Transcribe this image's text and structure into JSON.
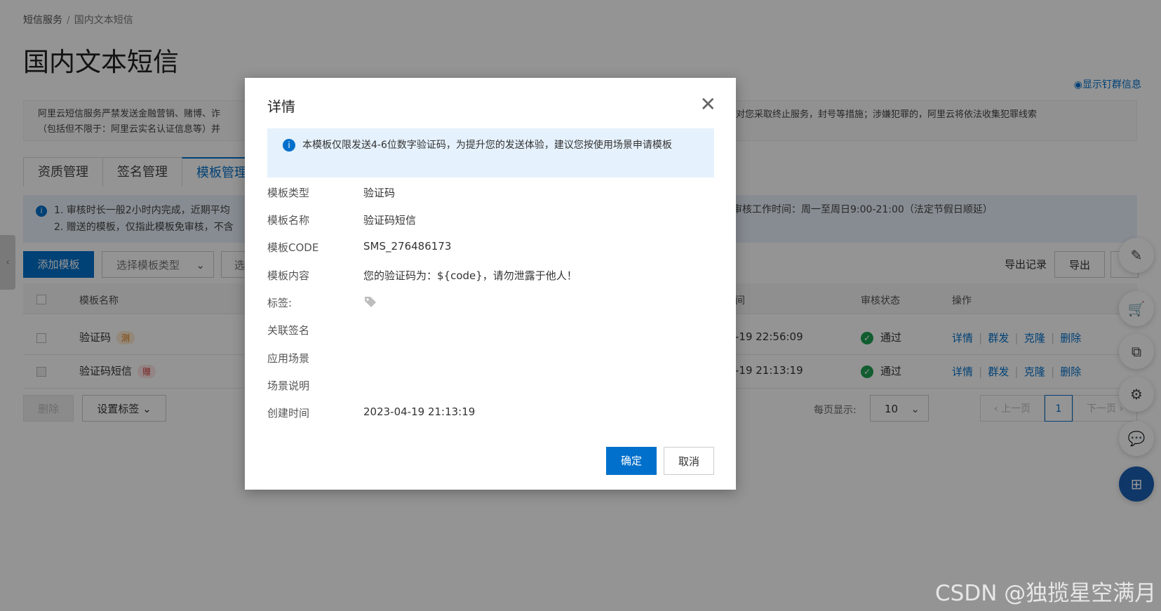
{
  "breadcrumb": {
    "root": "短信服务",
    "separator": "/",
    "current": "国内文本短信"
  },
  "page_title": "国内文本短信",
  "show_subscribe": "显示钉群信息",
  "notice": {
    "line1_start": "阿里云短信服务严禁发送金融营销、赌博、诈",
    "line1_end": "务协议对您采取终止服务，封号等措施；涉嫌犯罪的，阿里云将依法收集犯罪线索",
    "line2_start": "（包括但不限于：阿里云实名认证信息等）并"
  },
  "tabs": [
    {
      "label": "资质管理"
    },
    {
      "label": "签名管理"
    },
    {
      "label": "模板管理"
    }
  ],
  "tip": {
    "line1": "1. 审核时长一般2小时内完成，近期平均",
    "line2": "2. 赠送的模板，仅指此模板免审核，不含",
    "right": "审核工作时间：周一至周日9:00-21:00（法定节假日顺延）"
  },
  "toolbar": {
    "add_template": "添加模板",
    "select_type_placeholder": "选择模板类型",
    "select_second": "选",
    "export_records": "导出记录",
    "export": "导出"
  },
  "table": {
    "headers": {
      "name": "模板名称",
      "time": "间",
      "status": "审核状态",
      "actions": "操作"
    },
    "rows": [
      {
        "name": "验证码",
        "badge": "测",
        "badge_type": "test",
        "time": "-19 22:56:09",
        "status": "通过"
      },
      {
        "name": "验证码短信",
        "badge": "赠",
        "badge_type": "gift",
        "time": "-19 21:13:19",
        "status": "通过"
      }
    ],
    "action_labels": [
      "详情",
      "群发",
      "克隆",
      "删除"
    ]
  },
  "footer": {
    "delete": "删除",
    "set_tag": "设置标签",
    "per_page_label": "每页显示:",
    "per_page_value": "10",
    "prev": "上一页",
    "page": "1",
    "next": "下一页"
  },
  "modal": {
    "title": "详情",
    "notice": "本模板仅限发送4-6位数字验证码，为提升您的发送体验，建议您按使用场景申请模板",
    "fields": [
      {
        "label": "模板类型",
        "value": "验证码"
      },
      {
        "label": "模板名称",
        "value": "验证码短信"
      },
      {
        "label": "模板CODE",
        "value": "SMS_276486173"
      },
      {
        "label": "模板内容",
        "value": "您的验证码为：${code}，请勿泄露于他人！"
      },
      {
        "label": "标签:",
        "value": ""
      },
      {
        "label": "关联签名",
        "value": ""
      },
      {
        "label": "应用场景",
        "value": ""
      },
      {
        "label": "场景说明",
        "value": ""
      },
      {
        "label": "创建时间",
        "value": "2023-04-19 21:13:19"
      }
    ],
    "confirm": "确定",
    "cancel": "取消"
  },
  "watermark": "CSDN @独揽星空满月",
  "colors": {
    "primary": "#0070cc",
    "success": "#1ea052",
    "overlay": "rgba(0,0,0,0.42)"
  }
}
